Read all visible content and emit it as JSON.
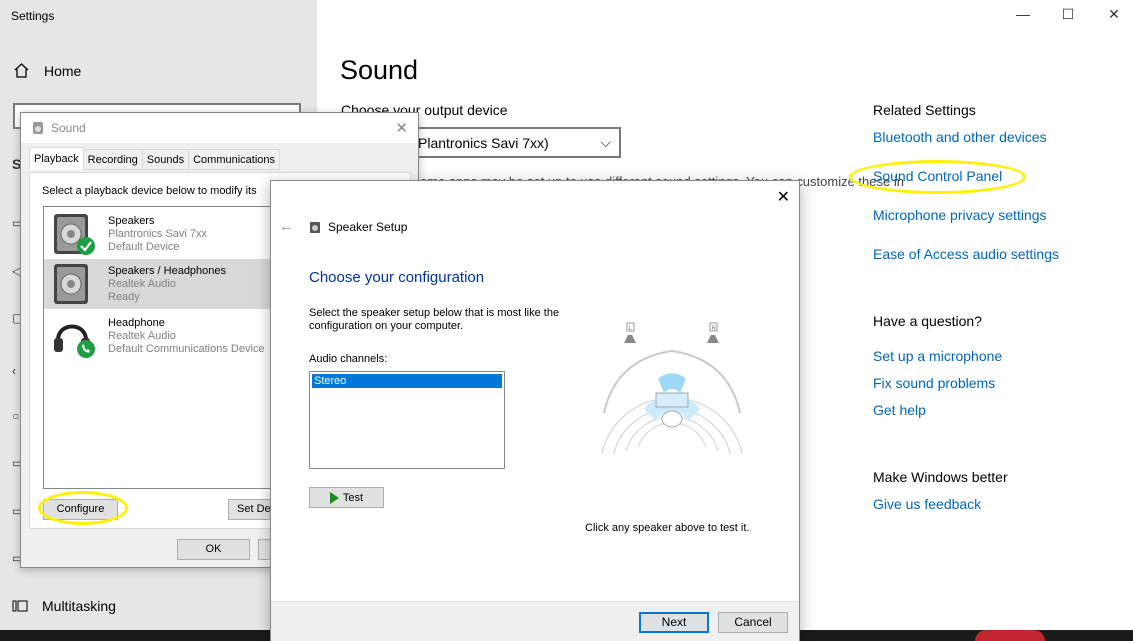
{
  "settings": {
    "window_title": "Settings",
    "home_label": "Home",
    "multitasking_label": "Multitasking",
    "page_title": "Sound",
    "output_label": "Choose your output device",
    "output_value": "Plantronics Savi 7xx)",
    "obscured_text": "ome apps may be set up to use different sound settings. You can customize these in",
    "window_controls": {
      "minimize": "—",
      "maximize": "☐",
      "close": "✕"
    }
  },
  "related": {
    "heading": "Related Settings",
    "links": [
      "Bluetooth and other devices",
      "Sound Control Panel",
      "Microphone privacy settings",
      "Ease of Access audio settings"
    ]
  },
  "question": {
    "heading": "Have a question?",
    "links": [
      "Set up a microphone",
      "Fix sound problems",
      "Get help"
    ]
  },
  "better": {
    "heading": "Make Windows better",
    "link": "Give us feedback"
  },
  "sound_dialog": {
    "title": "Sound",
    "close": "✕",
    "tabs": [
      "Playback",
      "Recording",
      "Sounds",
      "Communications"
    ],
    "active_tab": "Playback",
    "instruction": "Select a playback device below to modify its",
    "devices": [
      {
        "name": "Speakers",
        "model": "Plantronics Savi 7xx",
        "status": "Default Device",
        "badge": "check"
      },
      {
        "name": "Speakers / Headphones",
        "model": "Realtek Audio",
        "status": "Ready",
        "badge": "none"
      },
      {
        "name": "Headphone",
        "model": "Realtek Audio",
        "status": "Default Communications Device",
        "badge": "phone"
      }
    ],
    "configure_label": "Configure",
    "set_default_label": "Set De",
    "ok_label": "OK"
  },
  "speaker_setup": {
    "title": "Speaker Setup",
    "close": "✕",
    "back": "←",
    "heading": "Choose your configuration",
    "instruction": "Select the speaker setup below that is most like the configuration on your computer.",
    "channels_label": "Audio channels:",
    "channels": [
      "Stereo"
    ],
    "selected_channel": "Stereo",
    "test_label": "Test",
    "hint": "Click any speaker above to test it.",
    "speaker_labels": [
      "L",
      "R"
    ],
    "next_label": "Next",
    "cancel_label": "Cancel"
  },
  "colors": {
    "link": "#0067b8",
    "highlight": "#fff100",
    "selection": "#0078d7",
    "heading_blue": "#003399"
  }
}
